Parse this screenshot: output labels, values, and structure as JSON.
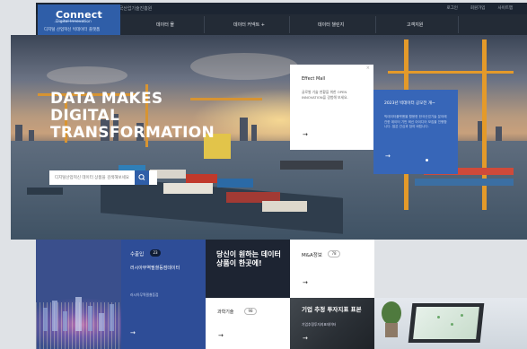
{
  "header": {
    "logo_title": "Connect",
    "logo_subtitle": "Digital Innovation",
    "logo_korean": "디지털 산업혁신 빅데이터 플랫폼",
    "utility_site": "한국산업기술진흥원",
    "utility_links": [
      "로그인",
      "회원가입",
      "사이트맵"
    ],
    "nav": [
      "데이터 몰",
      "데이터 커넥트 +",
      "데이터 챌린지",
      "고객지원"
    ]
  },
  "hero": {
    "title_lines": [
      "DATA MAKES",
      "DIGITAL",
      "TRANSFORMATION"
    ],
    "search_placeholder": "디지털산업혁신 데이터 상품을 검색해보세요"
  },
  "effect_mall": {
    "title": "Effect Mall",
    "desc": "글로벌 기술 현황을 위한 OPEN INNOVATION을 경험해 보세요.",
    "arrow": "→",
    "close": "×"
  },
  "news_card": {
    "title": "2023년 빅데이터 공모전 개~",
    "desc": "빅데이터플랫폼을 활용한 한국산업기술 분야에 관한 데이터 기반 혁신 아이디어 모집을 진행합니다. 많은 관심과 참여 바랍니다.",
    "arrow": "→"
  },
  "tiles": {
    "export_title": "수출입",
    "export_count": "23",
    "export_desc": "러시아무역필쳘등점데이터",
    "export_sub": "러시아무역필쳘등점",
    "export_arrow": "→",
    "promo_text": "당신이 원하는 데이터 상품이 한곳에!",
    "ma_title": "M&A정보",
    "ma_count": "78",
    "ma_arrow": "→",
    "tech_title": "과학기술",
    "tech_count": "98",
    "tech_arrow": "→",
    "invest_title": "기업 추정 투자지표 표본",
    "invest_sub": "기업추정투자지표데이터",
    "invest_arrow": "→"
  }
}
